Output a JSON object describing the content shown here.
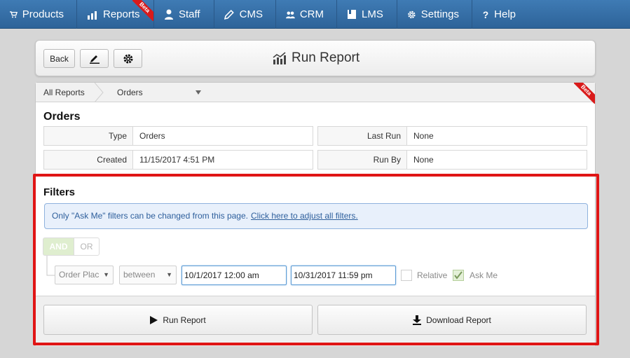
{
  "nav": {
    "items": [
      {
        "label": "Products",
        "icon": "cart-icon"
      },
      {
        "label": "Reports",
        "icon": "chart-icon",
        "badge": "Beta"
      },
      {
        "label": "Staff",
        "icon": "person-icon"
      },
      {
        "label": "CMS",
        "icon": "pencil-icon"
      },
      {
        "label": "CRM",
        "icon": "people-icon"
      },
      {
        "label": "LMS",
        "icon": "book-icon"
      },
      {
        "label": "Settings",
        "icon": "gear-icon"
      },
      {
        "label": "Help",
        "icon": "question-icon"
      }
    ]
  },
  "header": {
    "back_label": "Back",
    "title": "Run Report"
  },
  "breadcrumb": {
    "root": "All Reports",
    "current": "Orders",
    "badge": "Beta"
  },
  "report": {
    "name": "Orders",
    "type_label": "Type",
    "type_value": "Orders",
    "created_label": "Created",
    "created_value": "11/15/2017 4:51 PM",
    "last_run_label": "Last Run",
    "last_run_value": "None",
    "run_by_label": "Run By",
    "run_by_value": "None"
  },
  "filters": {
    "title": "Filters",
    "notice": "Only \"Ask Me\" filters can be changed from this page.",
    "notice_link": "Click here to adjust all filters.",
    "and_label": "AND",
    "or_label": "OR",
    "field_value": "Order Plac",
    "operator_value": "between",
    "date_from": "10/1/2017 12:00 am",
    "date_to": "10/31/2017 11:59 pm",
    "relative_label": "Relative",
    "relative_checked": false,
    "ask_me_label": "Ask Me",
    "ask_me_checked": true
  },
  "actions": {
    "run_label": "Run Report",
    "download_label": "Download Report"
  },
  "colors": {
    "nav_bg": "#2d6399",
    "highlight": "#e01515",
    "beta": "#d91a1a",
    "and_active": "#dfeecf"
  }
}
